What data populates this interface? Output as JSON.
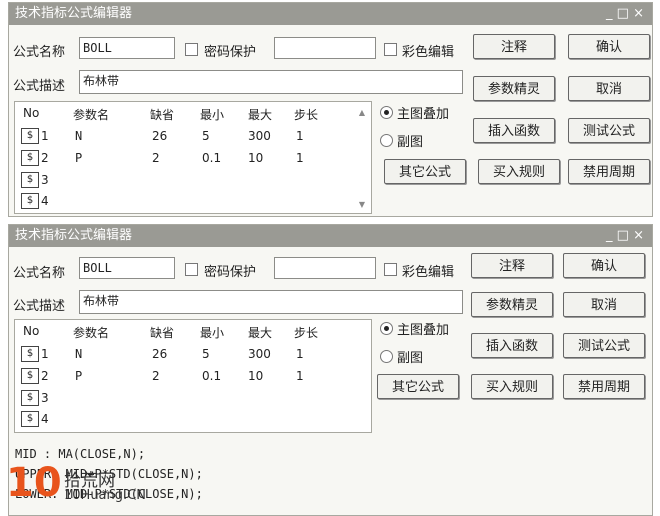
{
  "window1": {
    "title": "技术指标公式编辑器",
    "controls": "_ □ ×",
    "formula_name_label": "公式名称",
    "formula_name_value": "BOLL",
    "password_label": "密码保护",
    "color_edit_label": "彩色编辑",
    "formula_desc_label": "公式描述",
    "formula_desc_value": "布林带",
    "buttons": {
      "comment": "注释",
      "confirm": "确认",
      "param_wizard": "参数精灵",
      "cancel": "取消",
      "insert_function": "插入函数",
      "test_formula": "测试公式",
      "other_formula": "其它公式",
      "buy_rule": "买入规则",
      "disable_period": "禁用周期"
    },
    "radio_main_overlay": "主图叠加",
    "radio_sub_chart": "副图",
    "grid_headers": [
      "No",
      "参数名",
      "缺省",
      "最小",
      "最大",
      "步长"
    ],
    "rows": [
      {
        "no": "1",
        "name": "N",
        "default": "26",
        "min": "5",
        "max": "300",
        "step": "1"
      },
      {
        "no": "2",
        "name": "P",
        "default": "2",
        "min": "0.1",
        "max": "10",
        "step": "1"
      },
      {
        "no": "3"
      },
      {
        "no": "4"
      }
    ]
  },
  "window2": {
    "title": "技术指标公式编辑器",
    "controls": "_ □ ×",
    "formula_name_label": "公式名称",
    "formula_name_value": "BOLL",
    "password_label": "密码保护",
    "color_edit_label": "彩色编辑",
    "formula_desc_label": "公式描述",
    "formula_desc_value": "布林带",
    "buttons": {
      "comment": "注释",
      "confirm": "确认",
      "param_wizard": "参数精灵",
      "cancel": "取消",
      "insert_function": "插入函数",
      "test_formula": "测试公式",
      "other_formula": "其它公式",
      "buy_rule": "买入规则",
      "disable_period": "禁用周期"
    },
    "radio_main_overlay": "主图叠加",
    "radio_sub_chart": "副图",
    "grid_headers": [
      "No",
      "参数名",
      "缺省",
      "最小",
      "最大",
      "步长"
    ],
    "rows": [
      {
        "no": "1",
        "name": "N",
        "default": "26",
        "min": "5",
        "max": "300",
        "step": "1"
      },
      {
        "no": "2",
        "name": "P",
        "default": "2",
        "min": "0.1",
        "max": "10",
        "step": "1"
      },
      {
        "no": "3"
      },
      {
        "no": "4"
      }
    ],
    "code_lines": [
      "MID :  MA(CLOSE,N);",
      "UPPER: MID+P*STD(CLOSE,N);",
      "LOWER: MID-P*STD(CLOSE,N);"
    ]
  },
  "watermark": {
    "number": "10",
    "site": "拾荒网",
    "url": "10Huang.CN"
  }
}
